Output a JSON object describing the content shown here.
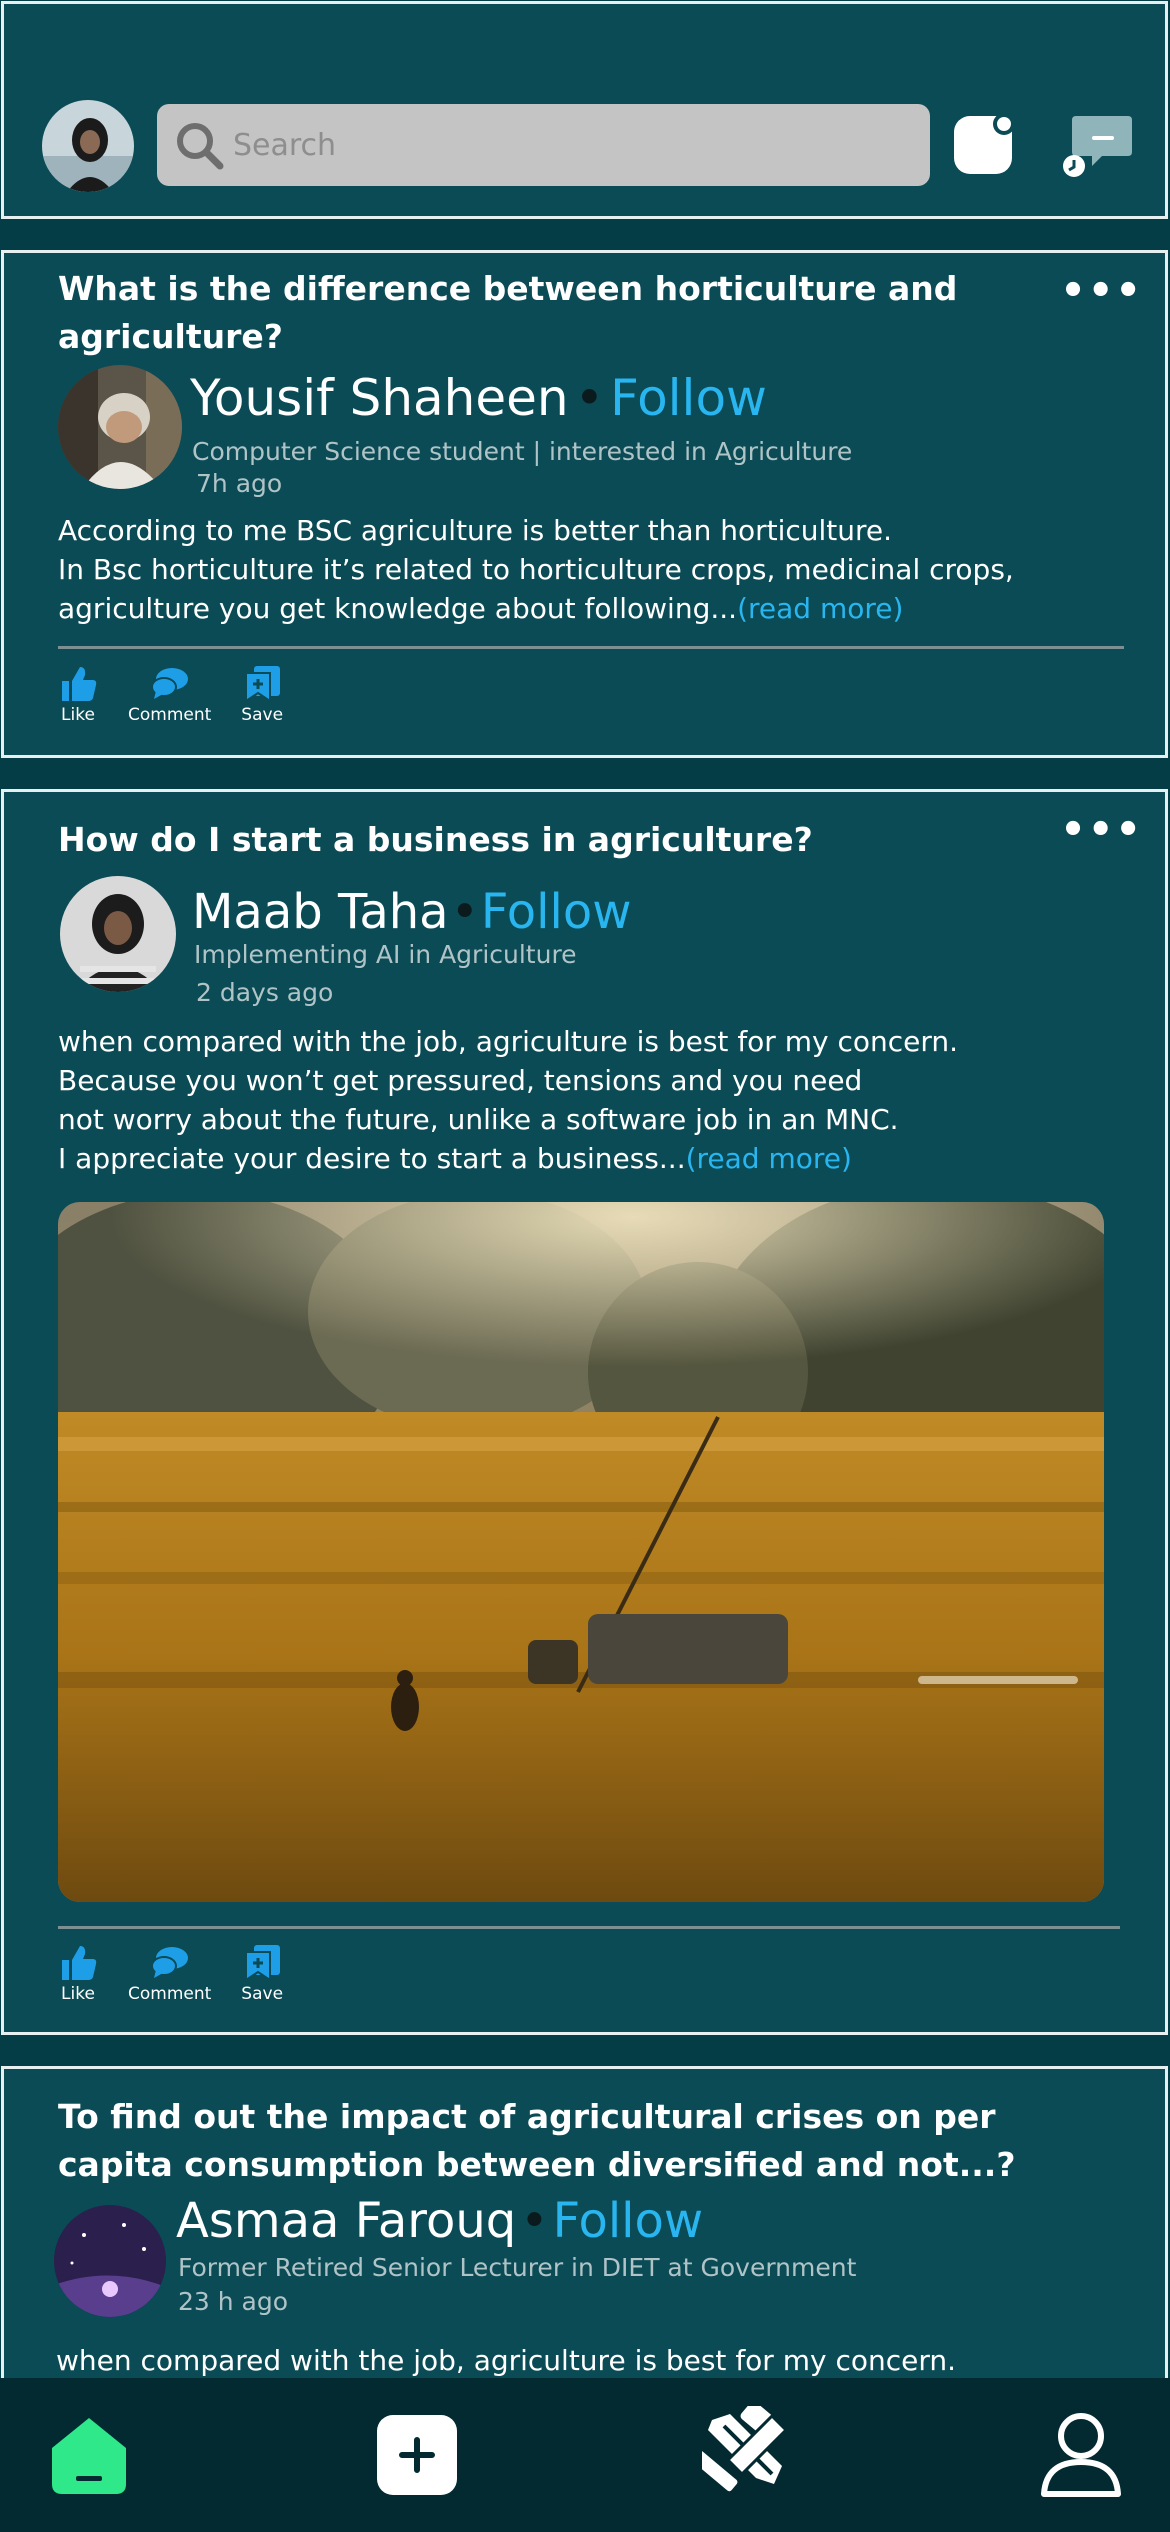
{
  "header": {
    "search": {
      "placeholder": "Search"
    },
    "icons": [
      "search-icon",
      "notification-icon",
      "chat-icon"
    ]
  },
  "posts": [
    {
      "question": "What is the difference between horticulture and agriculture?",
      "author": "Yousif Shaheen",
      "follow": "Follow",
      "bio": "Computer Science student | interested in Agriculture",
      "time": "7h ago",
      "body": [
        "According to me BSC agriculture is better than horticulture.",
        "In Bsc horticulture it’s related to horticulture crops, medicinal crops,",
        "agriculture you get knowledge about following..."
      ],
      "read_more": "(read more)",
      "actions": [
        "Like",
        "Comment",
        "Save"
      ]
    },
    {
      "question": "How do I start a business in agriculture?",
      "author": "Maab Taha",
      "follow": "Follow",
      "bio": "Implementing AI in Agriculture",
      "time": "2 days ago",
      "body": [
        "when compared with the job, agriculture is best for my concern.",
        "Because you won’t get pressured, tensions and you need",
        "not worry about the future, unlike a software job in an MNC.",
        "I appreciate your desire to start a business..."
      ],
      "read_more": "(read more)",
      "actions": [
        "Like",
        "Comment",
        "Save"
      ]
    },
    {
      "question": "To find out the impact of agricultural crises on per capita consumption between diversified and not...?",
      "author": "Asmaa Farouq",
      "follow": "Follow",
      "bio": "Former Retired Senior Lecturer in DIET at Government",
      "time": "23 h ago",
      "body": [
        "when compared with the job, agriculture is best for my concern."
      ]
    }
  ],
  "bottom_nav": [
    "home-icon",
    "add-icon",
    "tools-icon",
    "profile-icon"
  ],
  "colors": {
    "background": "#043d45",
    "card": "#0a4b55",
    "accent": "#29b6f0",
    "home_active": "#2ee88a"
  }
}
